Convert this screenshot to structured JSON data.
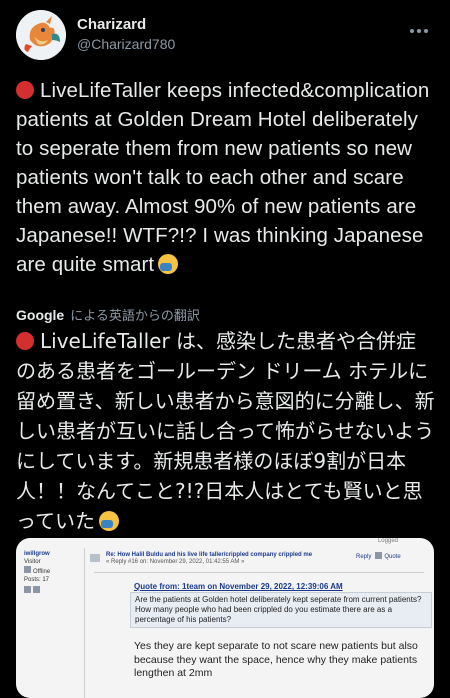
{
  "user": {
    "display_name": "Charizard",
    "handle": "@Charizard780"
  },
  "tweet": {
    "text": "LiveLifeTaller keeps infected&complication patients at Golden Dream Hotel deliberately to seperate them from new patients so new patients won't talk to each other and scare them away. Almost 90% of new patients are Japanese!! WTF?!? I was thinking Japanese are quite smart",
    "emoji_start": "red-circle-icon",
    "emoji_end": "face-palm-icon"
  },
  "translation": {
    "provider": "Google",
    "label": "による英語からの翻訳",
    "text": "LiveLifeTaller は、感染した患者や合併症のある患者をゴールーデン ドリーム ホテルに留め置き、新しい患者から意図的に分離し、新しい患者が互いに話し合って怖がらせないようにしています。新規患者様のほぼ9割が日本人！！なんてこと?!?日本人はとても賢いと思っていた"
  },
  "forum_screenshot": {
    "logged": "Logged",
    "username": "iwillgrow",
    "role": "Visitor",
    "status": "Offline",
    "posts": "Posts: 17",
    "title": "Re: How Halil Buldu and his live life taller/crippled company crippled me",
    "reply_meta": "« Reply #16 on: November 29, 2022, 01:42:55 AM »",
    "reply_btn": "Reply",
    "quote_btn": "Quote",
    "quote_from": "Quote from: 1team on November 29, 2022, 12:39:06 AM",
    "quote_text": "Are the patients at Golden hotel deliberately kept seperate from current patients? How many people who had been crippled do you estimate there are as a percentage of his patients?",
    "answer": "Yes they are kept separate to not scare new patients but also because they want the space, hence why they make patients lengthen at 2mm"
  }
}
